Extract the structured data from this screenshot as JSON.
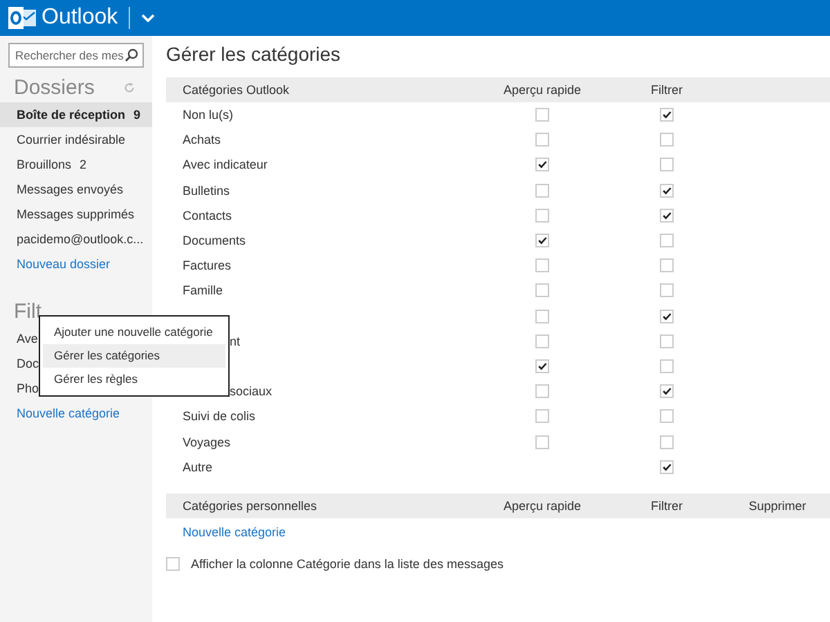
{
  "header": {
    "app_name": "Outlook"
  },
  "sidebar": {
    "search": {
      "placeholder": "Rechercher des mes"
    },
    "folders_title": "Dossiers",
    "folders": [
      {
        "label": "Boîte de réception",
        "count": "9",
        "selected": true
      },
      {
        "label": "Courrier indésirable",
        "selected": false
      },
      {
        "label": "Brouillons",
        "count": "2",
        "selected": false
      },
      {
        "label": "Messages envoyés",
        "selected": false
      },
      {
        "label": "Messages supprimés",
        "selected": false
      },
      {
        "label": "pacidemo@outlook.c...",
        "selected": false
      }
    ],
    "new_folder": "Nouveau dossier",
    "filters_title": "Filt",
    "filters": [
      "Ave",
      "Doc",
      "Pho"
    ],
    "new_category": "Nouvelle catégorie"
  },
  "main": {
    "title": "Gérer les catégories",
    "outlook_table": {
      "columns": [
        "Catégories Outlook",
        "Aperçu rapide",
        "Filtrer"
      ],
      "rows": [
        {
          "label": "Non lu(s)",
          "preview": false,
          "filter": true
        },
        {
          "label": "Achats",
          "preview": false,
          "filter": false
        },
        {
          "label": "Avec indicateur",
          "preview": true,
          "filter": false
        },
        {
          "label": "Bulletins",
          "preview": false,
          "filter": true
        },
        {
          "label": "Contacts",
          "preview": false,
          "filter": true
        },
        {
          "label": "Documents",
          "preview": true,
          "filter": false
        },
        {
          "label": "Factures",
          "preview": false,
          "filter": false
        },
        {
          "label": "Famille",
          "preview": false,
          "filter": false
        },
        {
          "preview": false,
          "filter": true
        },
        {
          "label": "nt",
          "covered": true,
          "preview": false,
          "filter": false
        },
        {
          "preview": true,
          "filter": false
        },
        {
          "label": "sociaux",
          "covered": true,
          "preview": false,
          "filter": true
        },
        {
          "label": "Suivi de colis",
          "preview": false,
          "filter": false
        },
        {
          "label": "Voyages",
          "preview": false,
          "filter": false
        },
        {
          "label": "Autre",
          "filter": true
        }
      ]
    },
    "personal_table": {
      "columns": [
        "Catégories personnelles",
        "Aperçu rapide",
        "Filtrer",
        "Supprimer"
      ],
      "new_category": "Nouvelle catégorie"
    },
    "show_column": {
      "label": "Afficher la colonne Catégorie dans la liste des messages",
      "checked": false
    }
  },
  "context_menu": {
    "items": [
      {
        "label": "Ajouter une nouvelle catégorie",
        "selected": false
      },
      {
        "label": "Gérer les catégories",
        "selected": true
      },
      {
        "label": "Gérer les règles",
        "selected": false
      }
    ]
  }
}
